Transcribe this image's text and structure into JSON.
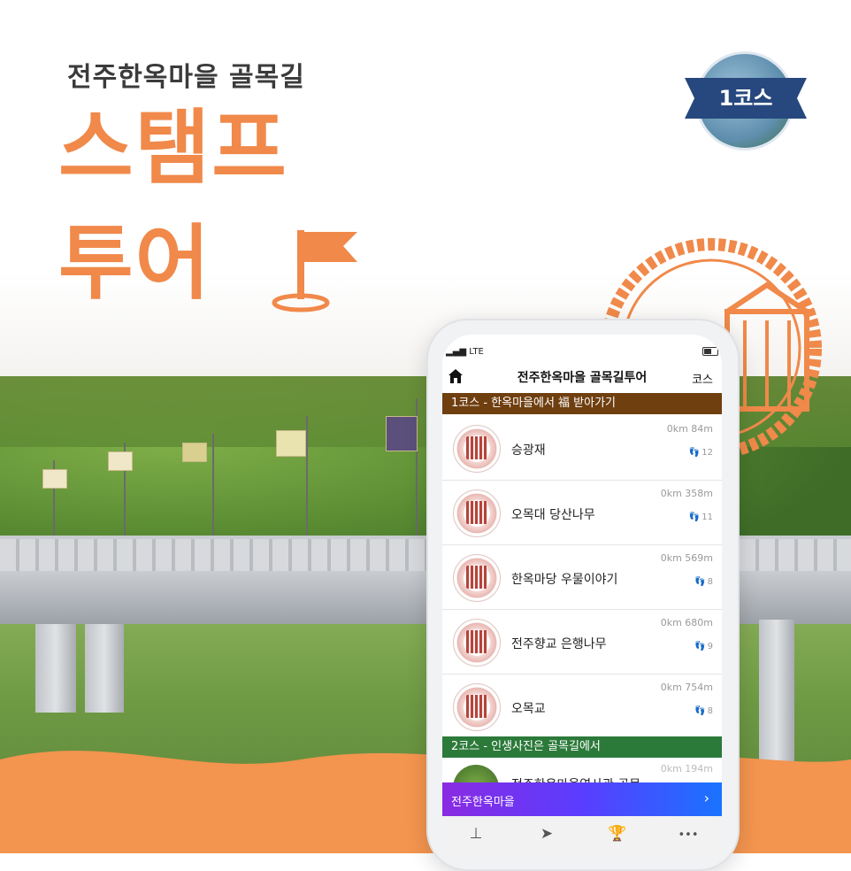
{
  "header": {
    "subtitle": "전주한옥마을 골목길",
    "title_line1": "스탬프",
    "title_line2": "투어"
  },
  "badge": {
    "label": "1코스"
  },
  "phone": {
    "status": {
      "signal": "LTE"
    },
    "appbar": {
      "title": "전주한옥마을 골목길투어",
      "course_link": "코스"
    },
    "section1": "1코스 - 한옥마을에서 福 받아가기",
    "section2": "2코스 - 인생사진은 골목길에서",
    "items": [
      {
        "name": "승광재",
        "distance": "0km 84m",
        "steps": "12"
      },
      {
        "name": "오목대 당산나무",
        "distance": "0km 358m",
        "steps": "11"
      },
      {
        "name": "한옥마당 우물이야기",
        "distance": "0km 569m",
        "steps": "8"
      },
      {
        "name": "전주향교 은행나무",
        "distance": "0km 680m",
        "steps": "9"
      },
      {
        "name": "오목교",
        "distance": "0km 754m",
        "steps": "8"
      }
    ],
    "partial_item": {
      "name": "전주한옥마을역사관 골목",
      "distance": "0km 194m"
    },
    "promo": {
      "label": "전주한옥마을",
      "arrow": "›"
    },
    "tabs": [
      {
        "icon": "stamp-icon",
        "glyph": "⊥"
      },
      {
        "icon": "navigation-icon",
        "glyph": "➤"
      },
      {
        "icon": "trophy-icon",
        "glyph": "🏆"
      },
      {
        "icon": "more-icon",
        "glyph": "•••"
      }
    ]
  },
  "colors": {
    "accent_orange": "#f0894a",
    "section1_bg": "#6f3f10",
    "section2_bg": "#2c7a3a",
    "ribbon": "#27487e"
  }
}
